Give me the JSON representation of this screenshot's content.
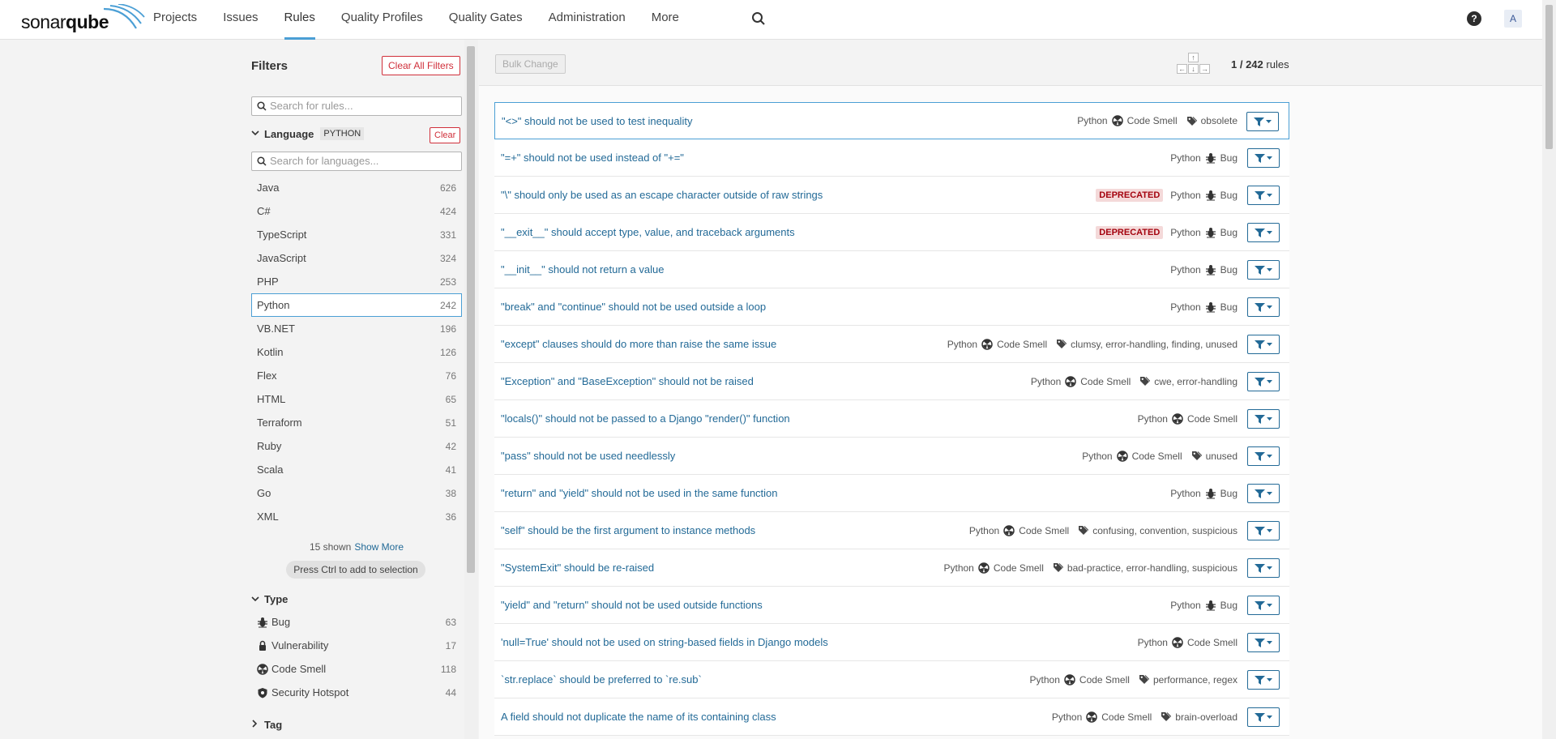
{
  "nav": {
    "logo_text_regular": "sonar",
    "logo_text_bold": "qube",
    "links": [
      "Projects",
      "Issues",
      "Rules",
      "Quality Profiles",
      "Quality Gates",
      "Administration",
      "More"
    ],
    "active": "Rules",
    "avatar_initial": "A",
    "help": "?"
  },
  "sidebar": {
    "title": "Filters",
    "clear_all": "Clear All Filters",
    "search_placeholder": "Search for rules...",
    "language_facet": {
      "title": "Language",
      "badge": "PYTHON",
      "clear": "Clear",
      "search_placeholder": "Search for languages...",
      "items": [
        {
          "label": "Java",
          "count": "626"
        },
        {
          "label": "C#",
          "count": "424"
        },
        {
          "label": "TypeScript",
          "count": "331"
        },
        {
          "label": "JavaScript",
          "count": "324"
        },
        {
          "label": "PHP",
          "count": "253"
        },
        {
          "label": "Python",
          "count": "242"
        },
        {
          "label": "VB.NET",
          "count": "196"
        },
        {
          "label": "Kotlin",
          "count": "126"
        },
        {
          "label": "Flex",
          "count": "76"
        },
        {
          "label": "HTML",
          "count": "65"
        },
        {
          "label": "Terraform",
          "count": "51"
        },
        {
          "label": "Ruby",
          "count": "42"
        },
        {
          "label": "Scala",
          "count": "41"
        },
        {
          "label": "Go",
          "count": "38"
        },
        {
          "label": "XML",
          "count": "36"
        }
      ],
      "shown": "15 shown",
      "show_more": "Show More",
      "ctrl_hint": "Press Ctrl to add to selection"
    },
    "type_facet": {
      "title": "Type",
      "items": [
        {
          "label": "Bug",
          "count": "63",
          "icon": "bug-icon"
        },
        {
          "label": "Vulnerability",
          "count": "17",
          "icon": "lock-icon"
        },
        {
          "label": "Code Smell",
          "count": "118",
          "icon": "code-smell-icon"
        },
        {
          "label": "Security Hotspot",
          "count": "44",
          "icon": "shield-icon"
        }
      ]
    },
    "tag_facet": {
      "title": "Tag"
    }
  },
  "toolbar": {
    "bulk_change": "Bulk Change",
    "keys": {
      "up": "↑",
      "down": "↓",
      "left": "←",
      "right": "→"
    },
    "paging_current": "1 / 242",
    "paging_label": "rules"
  },
  "rules": [
    {
      "title": "\"<>\" should not be used to test inequality",
      "lang": "Python",
      "type": "Code Smell",
      "tags": "obsolete",
      "deprecated": ""
    },
    {
      "title": "\"=+\" should not be used instead of \"+=\"",
      "lang": "Python",
      "type": "Bug",
      "tags": "",
      "deprecated": ""
    },
    {
      "title": "\"\\\" should only be used as an escape character outside of raw strings",
      "lang": "Python",
      "type": "Bug",
      "tags": "",
      "deprecated": "DEPRECATED"
    },
    {
      "title": "\"__exit__\" should accept type, value, and traceback arguments",
      "lang": "Python",
      "type": "Bug",
      "tags": "",
      "deprecated": "DEPRECATED"
    },
    {
      "title": "\"__init__\" should not return a value",
      "lang": "Python",
      "type": "Bug",
      "tags": "",
      "deprecated": ""
    },
    {
      "title": "\"break\" and \"continue\" should not be used outside a loop",
      "lang": "Python",
      "type": "Bug",
      "tags": "",
      "deprecated": ""
    },
    {
      "title": "\"except\" clauses should do more than raise the same issue",
      "lang": "Python",
      "type": "Code Smell",
      "tags": "clumsy, error-handling, finding, unused",
      "deprecated": ""
    },
    {
      "title": "\"Exception\" and \"BaseException\" should not be raised",
      "lang": "Python",
      "type": "Code Smell",
      "tags": "cwe, error-handling",
      "deprecated": ""
    },
    {
      "title": "\"locals()\" should not be passed to a Django \"render()\" function",
      "lang": "Python",
      "type": "Code Smell",
      "tags": "",
      "deprecated": ""
    },
    {
      "title": "\"pass\" should not be used needlessly",
      "lang": "Python",
      "type": "Code Smell",
      "tags": "unused",
      "deprecated": ""
    },
    {
      "title": "\"return\" and \"yield\" should not be used in the same function",
      "lang": "Python",
      "type": "Bug",
      "tags": "",
      "deprecated": ""
    },
    {
      "title": "\"self\" should be the first argument to instance methods",
      "lang": "Python",
      "type": "Code Smell",
      "tags": "confusing, convention, suspicious",
      "deprecated": ""
    },
    {
      "title": "\"SystemExit\" should be re-raised",
      "lang": "Python",
      "type": "Code Smell",
      "tags": "bad-practice, error-handling, suspicious",
      "deprecated": ""
    },
    {
      "title": "\"yield\" and \"return\" should not be used outside functions",
      "lang": "Python",
      "type": "Bug",
      "tags": "",
      "deprecated": ""
    },
    {
      "title": "'null=True' should not be used on string-based fields in Django models",
      "lang": "Python",
      "type": "Code Smell",
      "tags": "",
      "deprecated": ""
    },
    {
      "title": "`str.replace` should be preferred to `re.sub`",
      "lang": "Python",
      "type": "Code Smell",
      "tags": "performance, regex",
      "deprecated": ""
    },
    {
      "title": "A field should not duplicate the name of its containing class",
      "lang": "Python",
      "type": "Code Smell",
      "tags": "brain-overload",
      "deprecated": ""
    }
  ],
  "colors": {
    "link": "#236a97",
    "accent": "#4b9fd5",
    "danger": "#d02f3a"
  }
}
